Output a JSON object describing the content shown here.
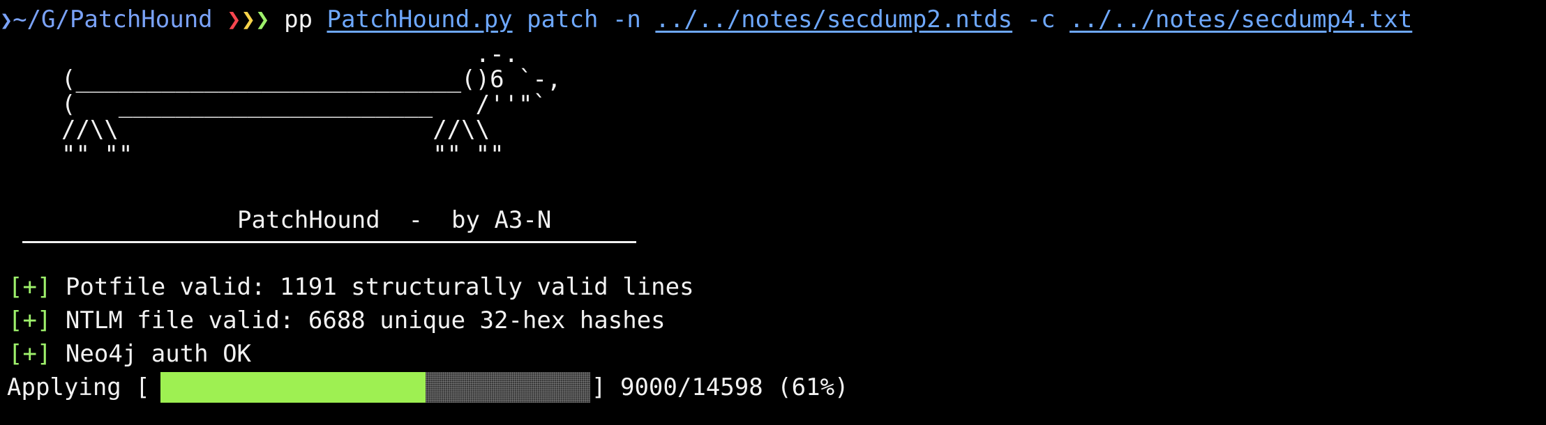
{
  "prompt": {
    "caret": "❯",
    "cwd": "~/G/PatchHound",
    "chevrons": [
      "❯",
      "❯",
      "❯"
    ],
    "command": "pp",
    "script": "PatchHound.py",
    "subcommand": "patch",
    "flag_n": "-n",
    "ntds_path": "../../notes/secdump2.ntds",
    "flag_c": "-c",
    "cracked_path": "../../notes/secdump4.txt"
  },
  "banner": {
    "art": "                             .-.\n(___________________________()6 `-,\n(   ______________________   /''\"`\n//\\\\                      //\\\\\n\"\" \"\"                     \"\" \"\"",
    "title": "PatchHound  -  by A3-N"
  },
  "status": [
    {
      "tag": "[+]",
      "text": "Potfile valid: 1191 structurally valid lines"
    },
    {
      "tag": "[+]",
      "text": "NTLM file valid: 6688 unique 32-hex hashes"
    },
    {
      "tag": "[+]",
      "text": "Neo4j auth OK"
    }
  ],
  "progress": {
    "label": "Applying [",
    "close_bracket": "]",
    "done": 9000,
    "total": 14598,
    "counts_text": "9000/14598",
    "percent_text": "(61%)",
    "fraction": 0.6166
  },
  "colors": {
    "background": "#000000",
    "path_blue": "#7aa2f7",
    "link_blue": "#6ea8fe",
    "chevron_red": "#f7464f",
    "chevron_yellow": "#f6d34a",
    "chevron_green": "#9ef06b",
    "tag_green": "#9ef06b",
    "bar_fill": "#9ef052"
  }
}
